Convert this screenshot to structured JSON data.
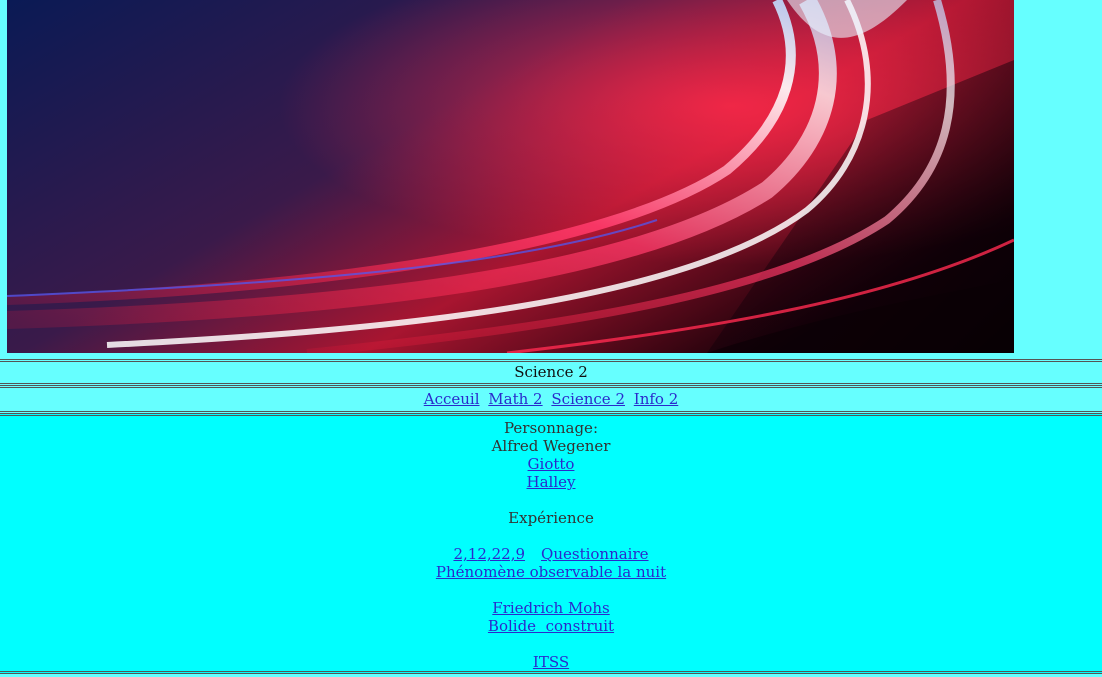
{
  "header": {
    "banner_alt": "",
    "title": "Science 2"
  },
  "nav": {
    "items": [
      {
        "label": "Acceuil"
      },
      {
        "label": "Math 2"
      },
      {
        "label": "Science 2"
      },
      {
        "label": "Info 2"
      }
    ]
  },
  "content": {
    "personnage_label": "Personnage:",
    "personnage_current": "Alfred Wegener",
    "personnage_links": [
      "Giotto",
      "Halley"
    ],
    "experience_label": "Expérience",
    "exercise_links": [
      "2,1",
      "2,2",
      "2,9"
    ],
    "questionnaire_link": "Questionnaire",
    "phenomene_link": "Phénomène observable la nuit",
    "mohs_link": "Friedrich Mohs",
    "bolide_link": "Bolide  construit",
    "itss_link": "ITSS"
  },
  "colors": {
    "page_background": "#66ffff",
    "content_background": "#00ffff",
    "link": "#2a2acc"
  }
}
